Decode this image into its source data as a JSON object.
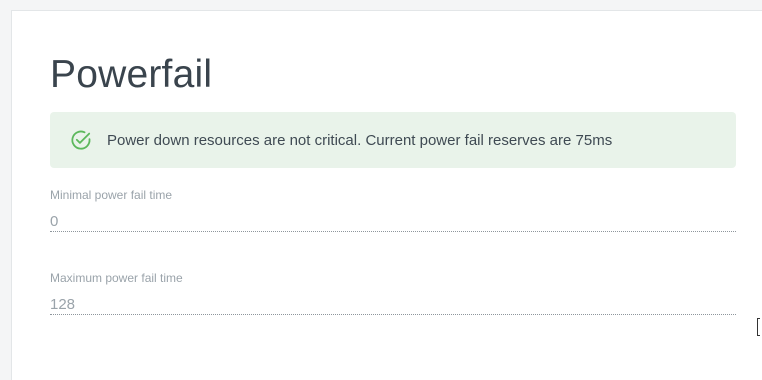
{
  "page": {
    "title": "Powerfail"
  },
  "alert": {
    "icon": "check-circle-icon",
    "message": "Power down resources are not critical. Current power fail reserves are 75ms",
    "color": "#5cb85c"
  },
  "fields": [
    {
      "label": "Minimal power fail time",
      "value": "0"
    },
    {
      "label": "Maximum power fail time",
      "value": "128"
    }
  ]
}
